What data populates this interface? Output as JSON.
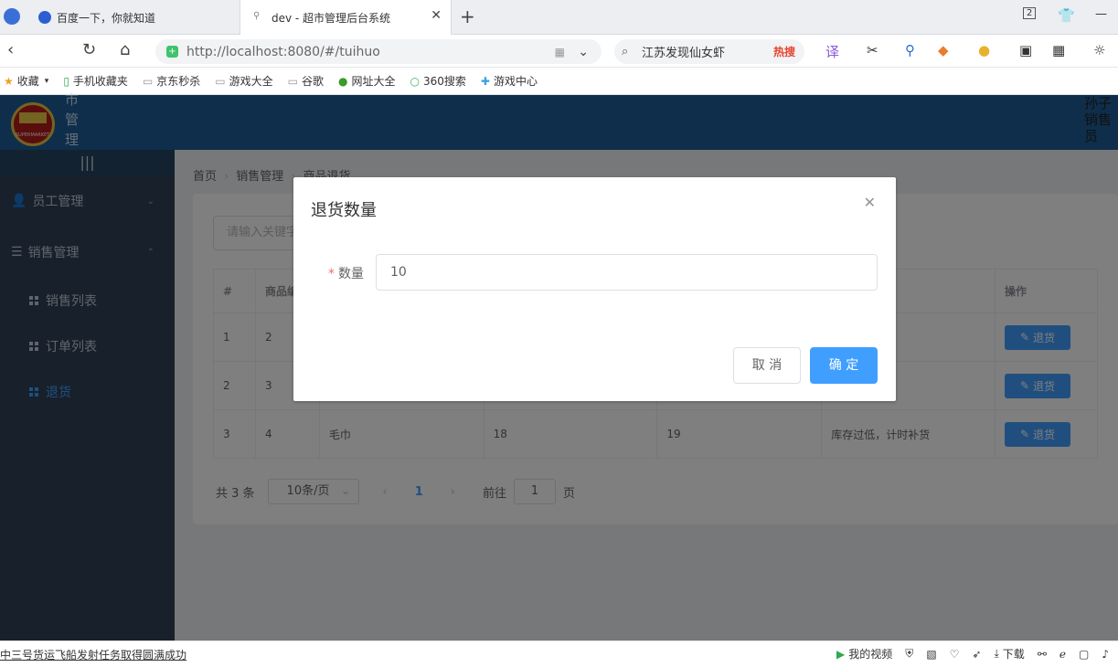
{
  "browser": {
    "tabs": [
      {
        "title": "百度一下，你就知道"
      },
      {
        "title": "dev - 超市管理后台系统"
      }
    ],
    "url": "http://localhost:8080/#/tuihuo",
    "search_text": "江苏发现仙女虾",
    "hot_label": "热搜",
    "tab_count": "2",
    "bookmarks": [
      "收藏",
      "手机收藏夹",
      "京东秒杀",
      "游戏大全",
      "谷歌",
      "网址大全",
      "360搜索",
      "游戏中心"
    ]
  },
  "app": {
    "system_title": "市管理系",
    "logo_text": "SUPERMARKET",
    "user_info": "孙子 销售员",
    "menu": {
      "toggle": "|||",
      "items": [
        {
          "label": "员工管理"
        },
        {
          "label": "销售管理"
        }
      ],
      "sub_items": [
        {
          "label": "销售列表"
        },
        {
          "label": "订单列表"
        },
        {
          "label": "退货"
        }
      ]
    },
    "breadcrumb": [
      "首页",
      "销售管理",
      "商品退货"
    ],
    "search_placeholder": "请输入关键字",
    "table": {
      "headers": [
        "#",
        "商品编",
        "",
        "",
        "",
        "",
        "操作"
      ],
      "rows": [
        {
          "idx": "1",
          "id": "2",
          "name": "",
          "c3": "",
          "c4": "",
          "note": ""
        },
        {
          "idx": "2",
          "id": "3",
          "name": "",
          "c3": "",
          "c4": "",
          "note": ""
        },
        {
          "idx": "3",
          "id": "4",
          "name": "毛巾",
          "c3": "18",
          "c4": "19",
          "note": "库存过低，计时补货"
        }
      ],
      "action_label": "退货"
    },
    "pagination": {
      "total": "共 3 条",
      "page_size": "10条/页",
      "current": "1",
      "goto_prefix": "前往",
      "goto_value": "1",
      "goto_suffix": "页"
    }
  },
  "dialog": {
    "title": "退货数量",
    "field_label": "数量",
    "field_value": "10",
    "cancel": "取 消",
    "confirm": "确 定"
  },
  "statusbar": {
    "message": "中三号货运飞船发射任务取得圆满成功",
    "video": "我的视频",
    "download": "下载"
  }
}
